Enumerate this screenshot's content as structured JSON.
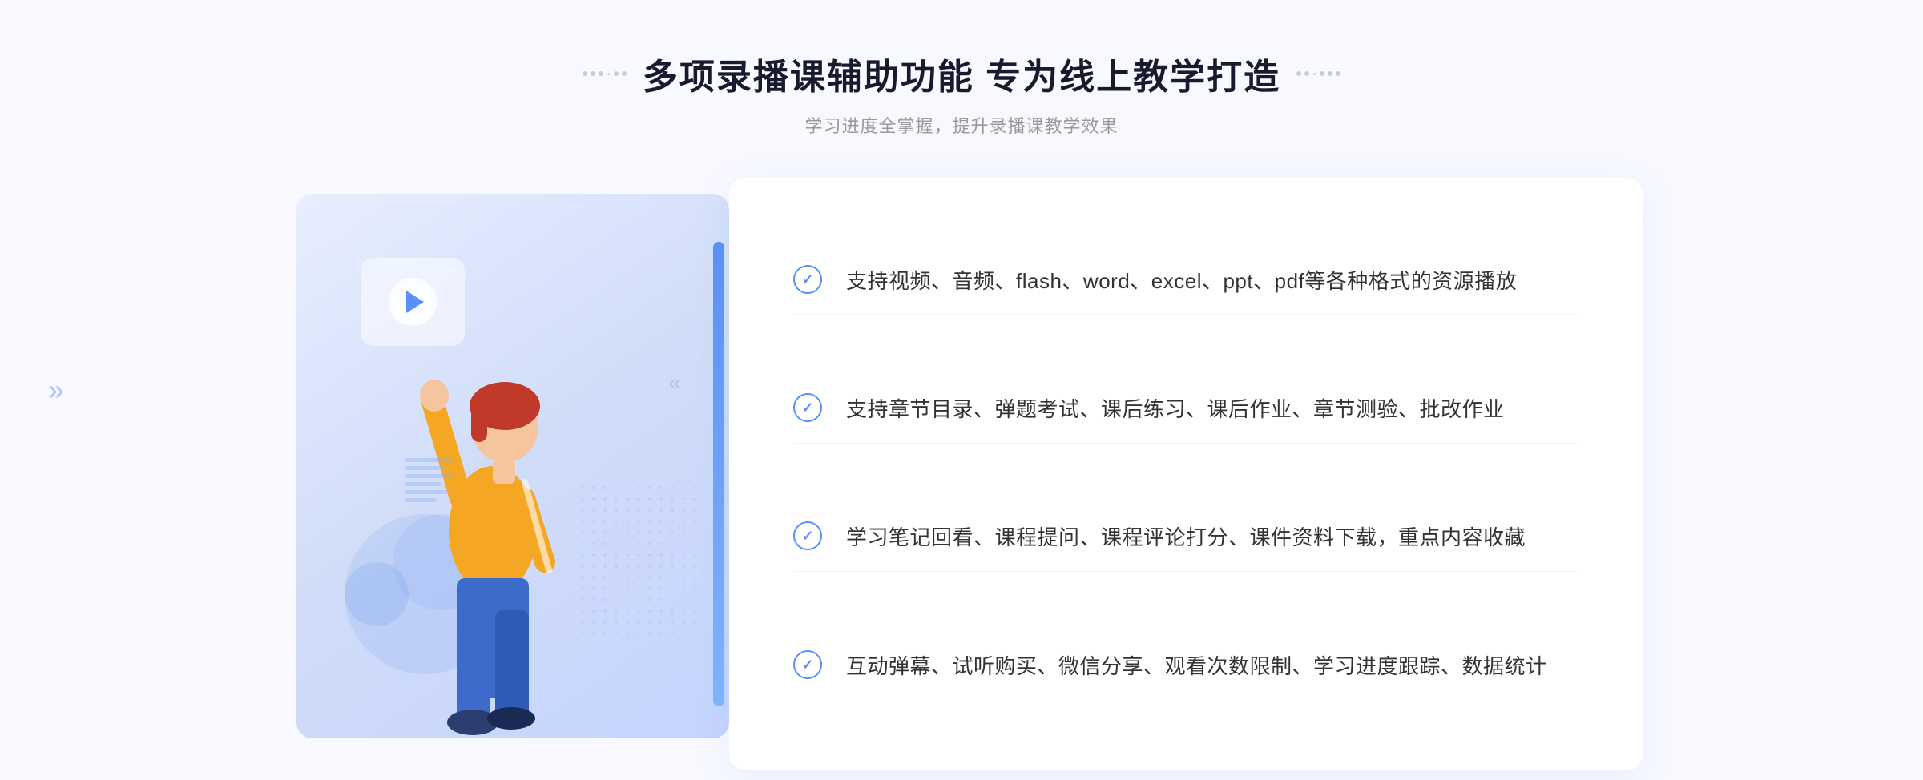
{
  "page": {
    "background_color": "#f5f7ff"
  },
  "header": {
    "title": "多项录播课辅助功能 专为线上教学打造",
    "subtitle": "学习进度全掌握，提升录播课教学效果",
    "title_deco_left": "···",
    "title_deco_right": "···"
  },
  "features": [
    {
      "id": 1,
      "text": "支持视频、音频、flash、word、excel、ppt、pdf等各种格式的资源播放"
    },
    {
      "id": 2,
      "text": "支持章节目录、弹题考试、课后练习、课后作业、章节测验、批改作业"
    },
    {
      "id": 3,
      "text": "学习笔记回看、课程提问、课程评论打分、课件资料下载，重点内容收藏"
    },
    {
      "id": 4,
      "text": "互动弹幕、试听购买、微信分享、观看次数限制、学习进度跟踪、数据统计"
    }
  ],
  "illustration": {
    "play_button_alt": "视频播放按钮"
  },
  "colors": {
    "primary_blue": "#5b8ff9",
    "light_blue": "#c5d4ff",
    "text_dark": "#1a1a2e",
    "text_gray": "#999999",
    "text_body": "#333333"
  }
}
